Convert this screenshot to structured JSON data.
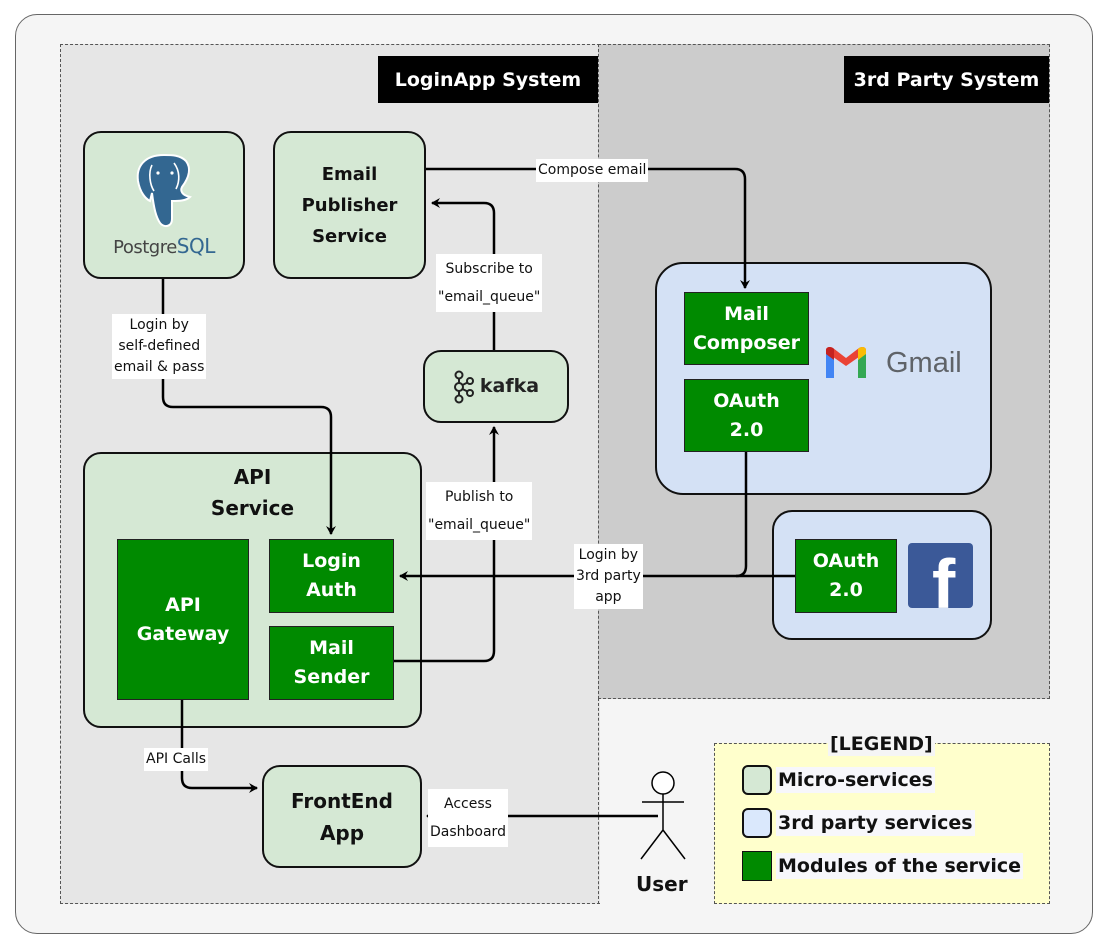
{
  "zones": {
    "loginapp": {
      "title": "LoginApp System"
    },
    "third_party": {
      "title": "3rd Party System"
    }
  },
  "services": {
    "postgres": {
      "brand_prefix": "Postgre",
      "brand_suffix": "SQL",
      "icon": "postgresql-elephant-icon"
    },
    "email_publisher": {
      "line1": "Email",
      "line2": "Publisher",
      "line3": "Service"
    },
    "kafka": {
      "label": "kafka",
      "icon": "kafka-icon"
    },
    "api_service": {
      "title_line1": "API",
      "title_line2": "Service",
      "modules": {
        "api_gateway": {
          "line1": "API",
          "line2": "Gateway"
        },
        "login_auth": {
          "line1": "Login",
          "line2": "Auth"
        },
        "mail_sender": {
          "line1": "Mail",
          "line2": "Sender"
        }
      }
    },
    "frontend": {
      "line1": "FrontEnd",
      "line2": "App"
    }
  },
  "third_party": {
    "gmail": {
      "brand": "Gmail",
      "icon": "gmail-icon",
      "modules": {
        "mail_composer": {
          "line1": "Mail",
          "line2": "Composer"
        },
        "oauth": {
          "line1": "OAuth",
          "line2": "2.0"
        }
      }
    },
    "facebook": {
      "icon": "facebook-icon",
      "glyph": "f",
      "modules": {
        "oauth": {
          "line1": "OAuth",
          "line2": "2.0"
        }
      }
    }
  },
  "actor": {
    "label": "User",
    "icon": "user-stick-figure-icon"
  },
  "edges": {
    "compose_email": {
      "line1": "Compose email"
    },
    "subscribe": {
      "line1": "Subscribe to",
      "line2": "\"email_queue\""
    },
    "login_self": {
      "line1": "Login by",
      "line2": "self-defined",
      "line3": "email & pass"
    },
    "publish": {
      "line1": "Publish to",
      "line2": "\"email_queue\""
    },
    "login_3rd": {
      "line1": "Login by",
      "line2": "3rd party",
      "line3": "app"
    },
    "api_calls": {
      "line1": "API Calls"
    },
    "access_dashboard": {
      "line1": "Access",
      "line2": "Dashboard"
    }
  },
  "legend": {
    "title": "[LEGEND]",
    "items": [
      {
        "label": "Micro-services",
        "color": "#d5e8d4"
      },
      {
        "label": "3rd party services",
        "color": "#dae8fc"
      },
      {
        "label": "Modules of the service",
        "color": "#008a00"
      }
    ]
  },
  "colors": {
    "microservice": "#d5e8d4",
    "third_party_service": "#d4e1f5",
    "module": "#008a00",
    "zone_loginapp": "#e6e6e6",
    "zone_third_party": "#cccccc",
    "legend_bg": "#ffffcc"
  }
}
